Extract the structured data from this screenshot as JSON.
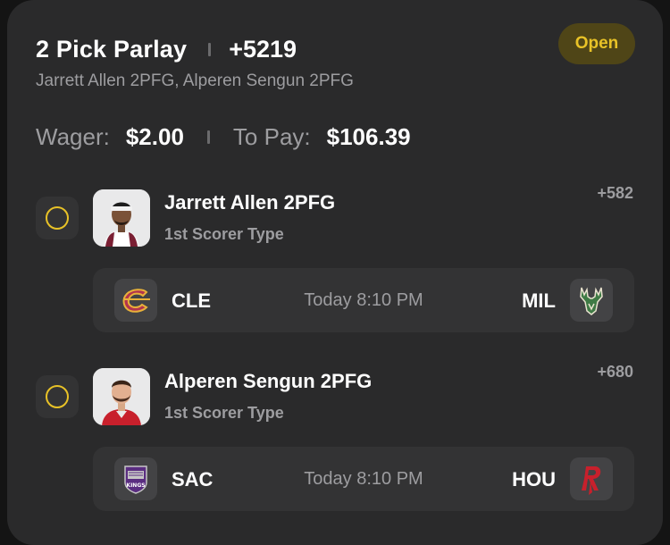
{
  "bet": {
    "title": "2 Pick Parlay",
    "odds": "+5219",
    "legs_summary": "Jarrett Allen 2PFG, Alperen Sengun 2PFG",
    "status": "Open",
    "wager_label": "Wager:",
    "wager_value": "$2.00",
    "payout_label": "To Pay:",
    "payout_value": "$106.39"
  },
  "picks": [
    {
      "name": "Jarrett Allen 2PFG",
      "type": "1st Scorer Type",
      "odds": "+582",
      "game": {
        "home": "CLE",
        "home_logo": "cavaliers-logo",
        "time": "Today 8:10 PM",
        "away": "MIL",
        "away_logo": "bucks-logo"
      }
    },
    {
      "name": "Alperen Sengun 2PFG",
      "type": "1st Scorer Type",
      "odds": "+680",
      "game": {
        "home": "SAC",
        "home_logo": "kings-logo",
        "time": "Today 8:10 PM",
        "away": "HOU",
        "away_logo": "rockets-logo"
      }
    }
  ],
  "colors": {
    "card_bg": "#2a2a2b",
    "accent_yellow": "#e8c227",
    "badge_bg": "#4f4517",
    "muted_text": "#9d9da0"
  }
}
